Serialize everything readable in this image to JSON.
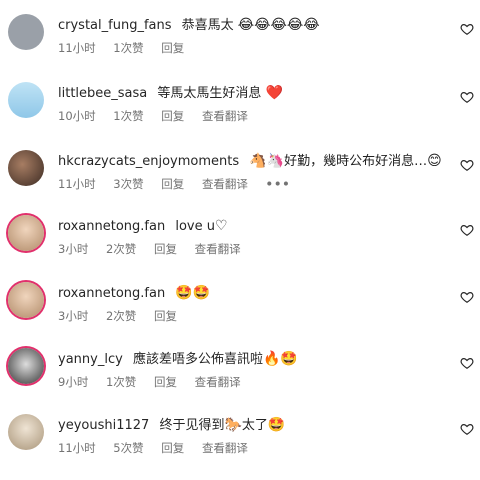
{
  "comments": [
    {
      "username": "crystal_fung_fans",
      "text": "恭喜馬太",
      "emojis": "😂😂😂😂😂",
      "time": "11小时",
      "likes": "1次赞",
      "reply": "回复",
      "see_translation": "",
      "avatar_color": "#9aa0a8"
    },
    {
      "username": "littlebee_sasa",
      "text": "等馬太馬生好消息",
      "emojis": "❤️",
      "time": "10小时",
      "likes": "1次赞",
      "reply": "回复",
      "see_translation": "查看翻译",
      "avatar_color": "#8fc7e8"
    },
    {
      "username": "hkcrazycats_enjoymoments",
      "text": "",
      "emojis": "🐴🦄",
      "text_after": "好勤，幾時公布好消息…",
      "emojis_after": "😊",
      "time": "11小时",
      "likes": "3次赞",
      "reply": "回复",
      "see_translation": "查看翻译",
      "more": "•••",
      "avatar_color": "#6b4b3a"
    },
    {
      "username": "roxannetong.fan",
      "text": "love u",
      "emojis": "♡",
      "time": "3小时",
      "likes": "2次赞",
      "reply": "回复",
      "see_translation": "查看翻译",
      "avatar_color": "#d8b79a"
    },
    {
      "username": "roxannetong.fan",
      "text": "",
      "emojis": "🤩🤩",
      "time": "3小时",
      "likes": "2次赞",
      "reply": "回复",
      "see_translation": "",
      "avatar_color": "#d8b79a"
    },
    {
      "username": "yanny_lcy",
      "text": "應該差唔多公佈喜訊啦",
      "emojis": "🔥🤩",
      "time": "9小时",
      "likes": "1次赞",
      "reply": "回复",
      "see_translation": "查看翻译",
      "avatar_color": "#4a4a55"
    },
    {
      "username": "yeyoushi1127",
      "text": "终于见得到",
      "emojis": "🐎",
      "text_after": "太了",
      "emojis_after": "🤩",
      "time": "11小时",
      "likes": "5次赞",
      "reply": "回复",
      "see_translation": "查看翻译",
      "avatar_color": "#c9b8a0"
    }
  ]
}
